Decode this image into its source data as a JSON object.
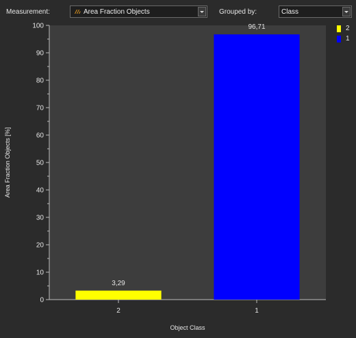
{
  "toolbar": {
    "measurement_label": "Measurement:",
    "measurement_value": "Area Fraction Objects",
    "grouped_label": "Grouped by:",
    "grouped_value": "Class",
    "measurement_icon": "area-fraction-icon"
  },
  "colors": {
    "background": "#2b2b2b",
    "plot_area": "#3d3d3d",
    "series_2": "#ffff00",
    "series_1": "#0000ff"
  },
  "chart_data": {
    "type": "bar",
    "categories": [
      "2",
      "1"
    ],
    "values": [
      3.29,
      96.71
    ],
    "value_labels": [
      "3,29",
      "96,71"
    ],
    "colors": [
      "#ffff00",
      "#0000ff"
    ],
    "xlabel": "Object Class",
    "ylabel": "Area Fraction Objects [%]",
    "ylim": [
      0,
      100
    ],
    "yticks": [
      0,
      10,
      20,
      30,
      40,
      50,
      60,
      70,
      80,
      90,
      100
    ],
    "legend": [
      {
        "name": "2",
        "color": "#ffff00"
      },
      {
        "name": "1",
        "color": "#0000ff"
      }
    ],
    "legend_position": "top-right",
    "grid": false
  }
}
